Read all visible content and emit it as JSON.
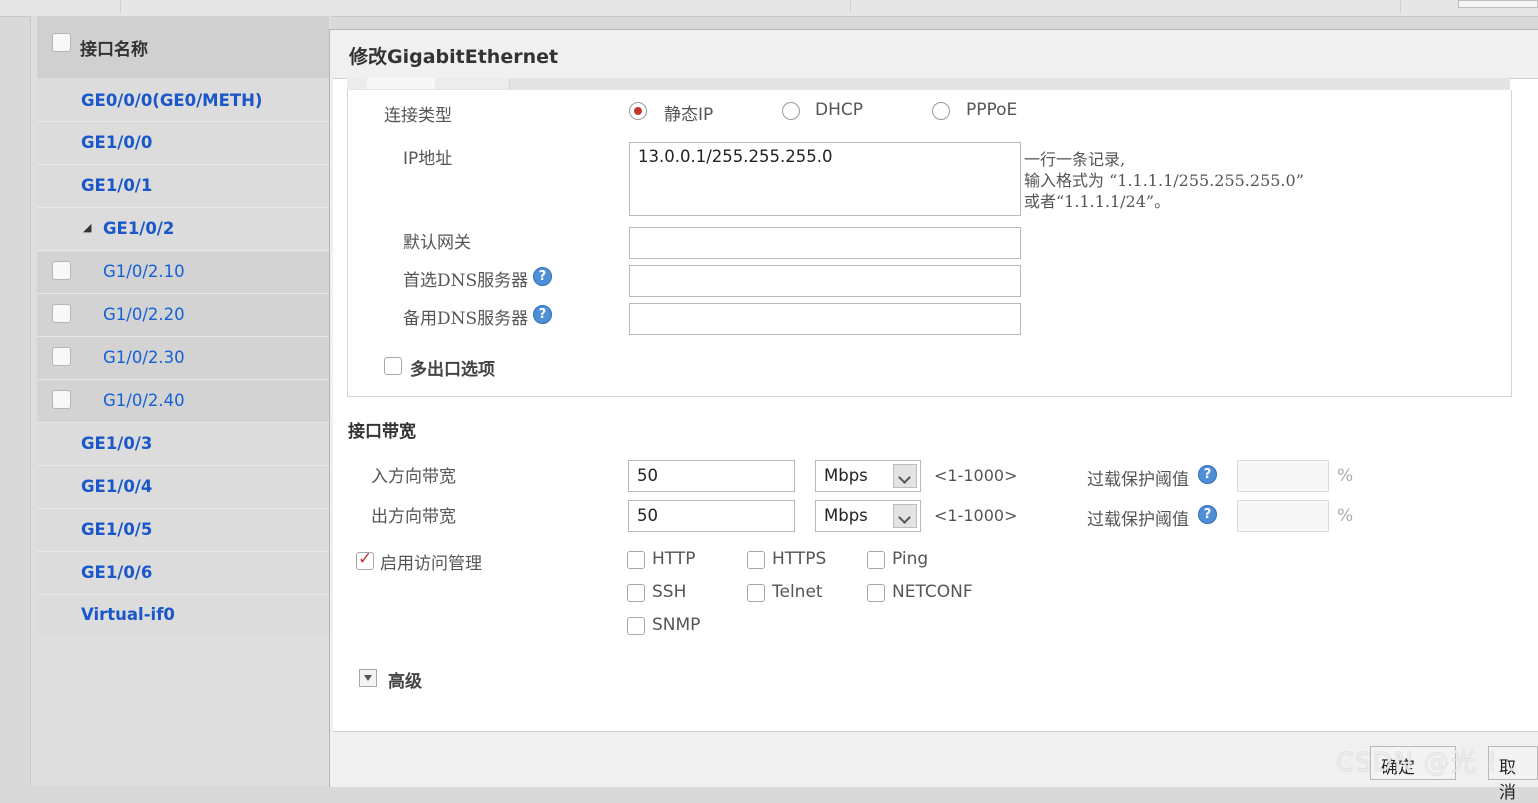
{
  "dialog": {
    "title": "修改GigabitEthernet"
  },
  "left_panel": {
    "header": "接口名称",
    "items": [
      {
        "label": "GE0/0/0(GE0/METH)"
      },
      {
        "label": "GE1/0/0"
      },
      {
        "label": "GE1/0/1"
      },
      {
        "label": "GE1/0/2"
      },
      {
        "label": "G1/0/2.10"
      },
      {
        "label": "G1/0/2.20"
      },
      {
        "label": "G1/0/2.30"
      },
      {
        "label": "G1/0/2.40"
      },
      {
        "label": "GE1/0/3"
      },
      {
        "label": "GE1/0/4"
      },
      {
        "label": "GE1/0/5"
      },
      {
        "label": "GE1/0/6"
      },
      {
        "label": "Virtual-if0"
      }
    ]
  },
  "connection": {
    "label": "连接类型",
    "options": [
      "静态IP",
      "DHCP",
      "PPPoE"
    ],
    "selected": "静态IP"
  },
  "ip": {
    "label": "IP地址",
    "value": "13.0.0.1/255.255.255.0",
    "hint": [
      "一行一条记录,",
      "输入格式为 “1.1.1.1/255.255.255.0”",
      "或者“1.1.1.1/24”。"
    ]
  },
  "gateway": {
    "label": "默认网关",
    "value": ""
  },
  "dns_primary": {
    "label": "首选DNS服务器",
    "value": ""
  },
  "dns_secondary": {
    "label": "备用DNS服务器",
    "value": ""
  },
  "multi_exit": {
    "label": "多出口选项",
    "checked": false
  },
  "bandwidth": {
    "title": "接口带宽",
    "inbound": {
      "label": "入方向带宽",
      "value": "50",
      "unit": "Mbps",
      "range": "<1-1000>",
      "overload_label": "过载保护阈值",
      "overload_value": "",
      "percent": "%"
    },
    "outbound": {
      "label": "出方向带宽",
      "value": "50",
      "unit": "Mbps",
      "range": "<1-1000>",
      "overload_label": "过载保护阈值",
      "overload_value": "",
      "percent": "%"
    }
  },
  "access": {
    "label": "启用访问管理",
    "checked": true,
    "protocols": [
      {
        "name": "HTTP",
        "checked": false
      },
      {
        "name": "HTTPS",
        "checked": false
      },
      {
        "name": "Ping",
        "checked": false
      },
      {
        "name": "SSH",
        "checked": false
      },
      {
        "name": "Telnet",
        "checked": false
      },
      {
        "name": "NETCONF",
        "checked": false
      },
      {
        "name": "SNMP",
        "checked": false
      }
    ]
  },
  "advanced": {
    "label": "高级"
  },
  "footer": {
    "ok": "确定",
    "cancel": "取消"
  },
  "watermark": "CSDN @光 ! ."
}
